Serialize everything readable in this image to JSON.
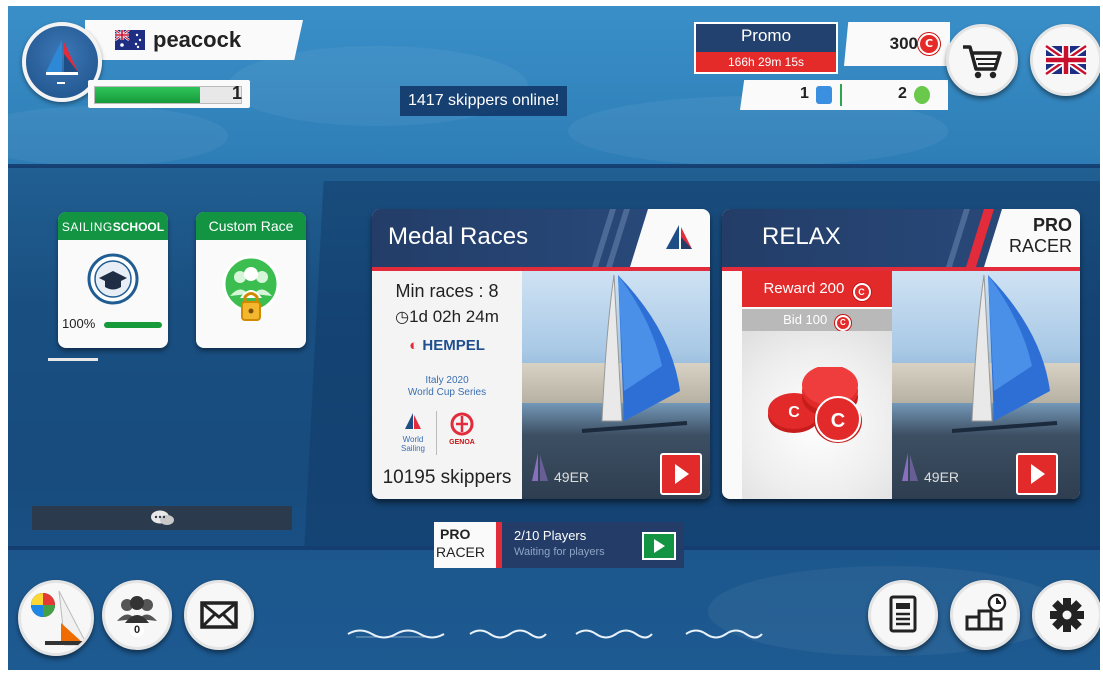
{
  "profile": {
    "username": "peacock",
    "level": "1",
    "xp_fraction": 0.72,
    "flag_icon": "australia-flag-icon"
  },
  "online_status": "1417 skippers online!",
  "promo": {
    "title": "Promo",
    "timer": "166h 29m 15s"
  },
  "currency": {
    "coins": "300",
    "coin_symbol": "C",
    "item_blue": "1",
    "item_green": "2"
  },
  "left_cards": {
    "sailing_school": {
      "title_part1": "SAILING",
      "title_part2": "SCHOOL",
      "progress": "100%",
      "progress_fraction": 1.0
    },
    "custom_race": {
      "title": "Custom Race"
    }
  },
  "medal_card": {
    "title": "Medal Races",
    "min_races": "Min races : 8",
    "timer": "1d 02h 24m",
    "sponsor": "HEMPEL",
    "series_line1": "Italy 2020",
    "series_line2": "World Cup Series",
    "logo1_line1": "World",
    "logo1_line2": "Sailing",
    "logo2": "GENOA",
    "skippers": "10195 skippers",
    "boat_class": "49ER"
  },
  "relax_card": {
    "title": "RELAX",
    "badge_top": "PRO",
    "badge_bottom": "RACER",
    "reward": "Reward 200",
    "bid": "Bid 100",
    "boat_class": "49ER"
  },
  "pro_racer_strip": {
    "logo_top": "PRO",
    "logo_bottom": "RACER",
    "players": "2/10 Players",
    "status": "Waiting for players"
  },
  "friends_count": "0",
  "colors": {
    "accent_red": "#e32a2a",
    "navy": "#233d68",
    "green": "#129443",
    "ocean_blue": "#2f7fb8"
  }
}
